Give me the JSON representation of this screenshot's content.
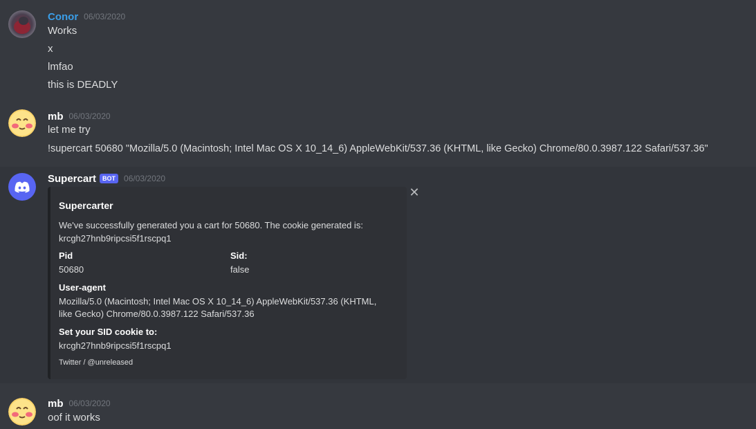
{
  "messages": [
    {
      "author": "Conor",
      "timestamp": "06/03/2020",
      "lines": [
        "Works",
        "x",
        "lmfao",
        "this is DEADLY"
      ]
    },
    {
      "author": "mb",
      "timestamp": "06/03/2020",
      "lines": [
        "let me try",
        "!supercart 50680 \"Mozilla/5.0 (Macintosh; Intel Mac OS X 10_14_6) AppleWebKit/537.36 (KHTML, like Gecko) Chrome/80.0.3987.122 Safari/537.36\""
      ]
    },
    {
      "author": "Supercart",
      "bot_tag": "BOT",
      "timestamp": "06/03/2020"
    },
    {
      "author": "mb",
      "timestamp": "06/03/2020",
      "lines": [
        "oof it works"
      ]
    }
  ],
  "embed": {
    "title": "Supercarter",
    "description_line1": "We've successfully generated you a cart for 50680. The cookie generated is:",
    "description_line2": "krcgh27hnb9ripcsi5f1rscpq1",
    "fields": [
      {
        "name": "Pid",
        "value": "50680"
      },
      {
        "name": "Sid:",
        "value": "false"
      },
      {
        "name": "User-agent",
        "value_line1": "Mozilla/5.0 (Macintosh; Intel Mac OS X 10_14_6) AppleWebKit/537.36 (KHTML,",
        "value_line2": "like Gecko) Chrome/80.0.3987.122 Safari/537.36"
      },
      {
        "name": "Set your SID cookie to:",
        "value": "krcgh27hnb9ripcsi5f1rscpq1"
      }
    ],
    "footer": "Twitter / @unreleased",
    "close_glyph": "✕"
  },
  "colors": {
    "background": "#36393f",
    "accent_blue": "#3a9ee8",
    "bot_tag": "#5865f2",
    "discord_blurple": "#5865f2"
  },
  "icons": {
    "conor_avatar": "user-photo-avatar",
    "mb_avatar": "blushing-smiley-avatar",
    "supercart_avatar": "discord-logo-avatar"
  }
}
